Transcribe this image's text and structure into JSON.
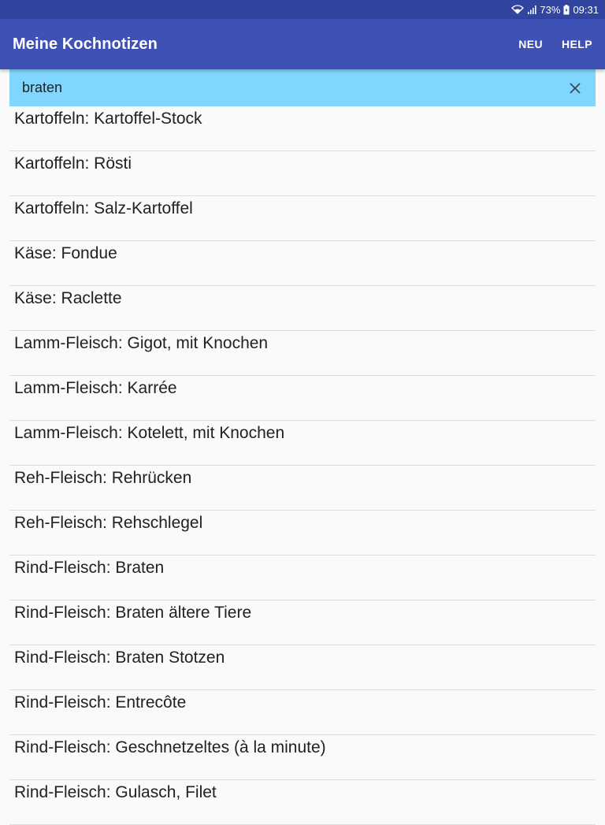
{
  "status_bar": {
    "battery": "73%",
    "time": "09:31",
    "icons": [
      "wifi-icon",
      "signal-icon",
      "battery-icon"
    ]
  },
  "app_bar": {
    "title": "Meine Kochnotizen",
    "actions": {
      "new_label": "NEU",
      "help_label": "HELP"
    }
  },
  "search": {
    "value": "braten",
    "clear_icon": "close-icon"
  },
  "recipes": [
    "Kartoffeln: Kartoffel-Stock",
    "Kartoffeln: Rösti",
    "Kartoffeln: Salz-Kartoffel",
    "Käse: Fondue",
    "Käse: Raclette",
    "Lamm-Fleisch: Gigot, mit Knochen",
    "Lamm-Fleisch: Karrée",
    "Lamm-Fleisch: Kotelett, mit Knochen",
    "Reh-Fleisch: Rehrücken",
    "Reh-Fleisch: Rehschlegel",
    "Rind-Fleisch: Braten",
    "Rind-Fleisch: Braten ältere Tiere",
    "Rind-Fleisch: Braten Stotzen",
    "Rind-Fleisch: Entrecôte",
    "Rind-Fleisch: Geschnetzeltes (à la minute)",
    "Rind-Fleisch: Gulasch, Filet"
  ],
  "colors": {
    "status_bar": "#3144a0",
    "app_bar": "#3f51b5",
    "search_bg": "#80d6ff",
    "background": "#fafafa"
  }
}
